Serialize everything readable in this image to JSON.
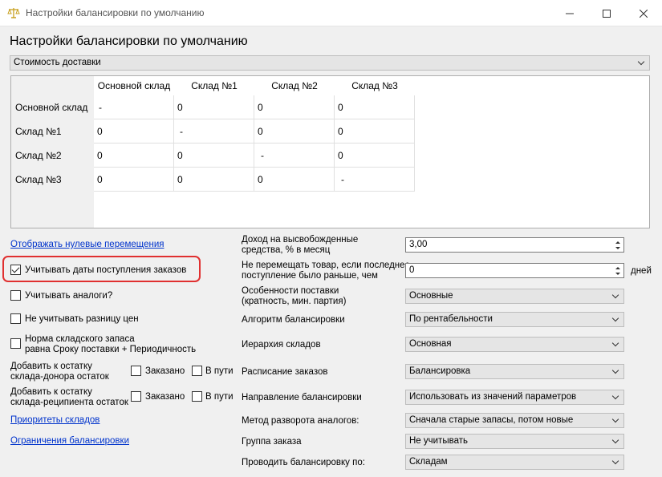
{
  "window": {
    "title": "Настройки балансировки по умолчанию"
  },
  "page_title": "Настройки балансировки по умолчанию",
  "cost_type": {
    "value": "Стоимость доставки"
  },
  "grid": {
    "columns": [
      "Основной склад",
      "Склад №1",
      "Склад №2",
      "Склад №3"
    ],
    "rows": [
      {
        "name": "Основной склад",
        "cells": [
          "-",
          "0",
          "0",
          "0"
        ]
      },
      {
        "name": "Склад №1",
        "cells": [
          "0",
          "-",
          "0",
          "0"
        ]
      },
      {
        "name": "Склад №2",
        "cells": [
          "0",
          "0",
          "-",
          "0"
        ]
      },
      {
        "name": "Склад №3",
        "cells": [
          "0",
          "0",
          "0",
          "-"
        ]
      }
    ]
  },
  "left": {
    "show_zero_link": "Отображать нулевые перемещения",
    "consider_order_dates": {
      "label": "Учитывать даты поступления заказов",
      "checked": true
    },
    "consider_analogs": {
      "label": "Учитывать аналоги?",
      "checked": false
    },
    "ignore_price_diff": {
      "label": "Не учитывать разницу цен",
      "checked": false
    },
    "stock_norm": {
      "label1": "Норма складского запаса",
      "label2": "равна Сроку поставки + Периодичность",
      "checked": false
    },
    "donor": {
      "label1": "Добавить к остатку",
      "label2": "склада-донора остаток",
      "ordered": "Заказано",
      "in_transit": "В пути"
    },
    "recipient": {
      "label1": "Добавить к остатку",
      "label2": "склада-реципиента остаток",
      "ordered": "Заказано",
      "in_transit": "В пути"
    },
    "priorities_link": "Приоритеты складов",
    "limits_link": "Ограничения балансировки"
  },
  "right": {
    "income": {
      "label1": "Доход на высвобожденные",
      "label2": "средства, % в месяц",
      "value": "3,00"
    },
    "no_move": {
      "label1": "Не перемещать товар, если последнее",
      "label2": "поступление было раньше, чем",
      "value": "0",
      "unit": "дней"
    },
    "supply_features": {
      "label1": "Особенности поставки",
      "label2": "(кратность, мин. партия)",
      "value": "Основные"
    },
    "algorithm": {
      "label": "Алгоритм балансировки",
      "value": "По рентабельности"
    },
    "hierarchy": {
      "label": "Иерархия складов",
      "value": "Основная"
    },
    "schedule": {
      "label": "Расписание заказов",
      "value": "Балансировка"
    },
    "direction": {
      "label": "Направление балансировки",
      "value": "Использовать из значений параметров"
    },
    "analog_method": {
      "label": "Метод разворота аналогов:",
      "value": "Сначала старые запасы, потом новые"
    },
    "order_group": {
      "label": "Группа заказа",
      "value": "Не учитывать"
    },
    "balance_by": {
      "label": "Проводить балансировку по:",
      "value": "Складам"
    }
  }
}
